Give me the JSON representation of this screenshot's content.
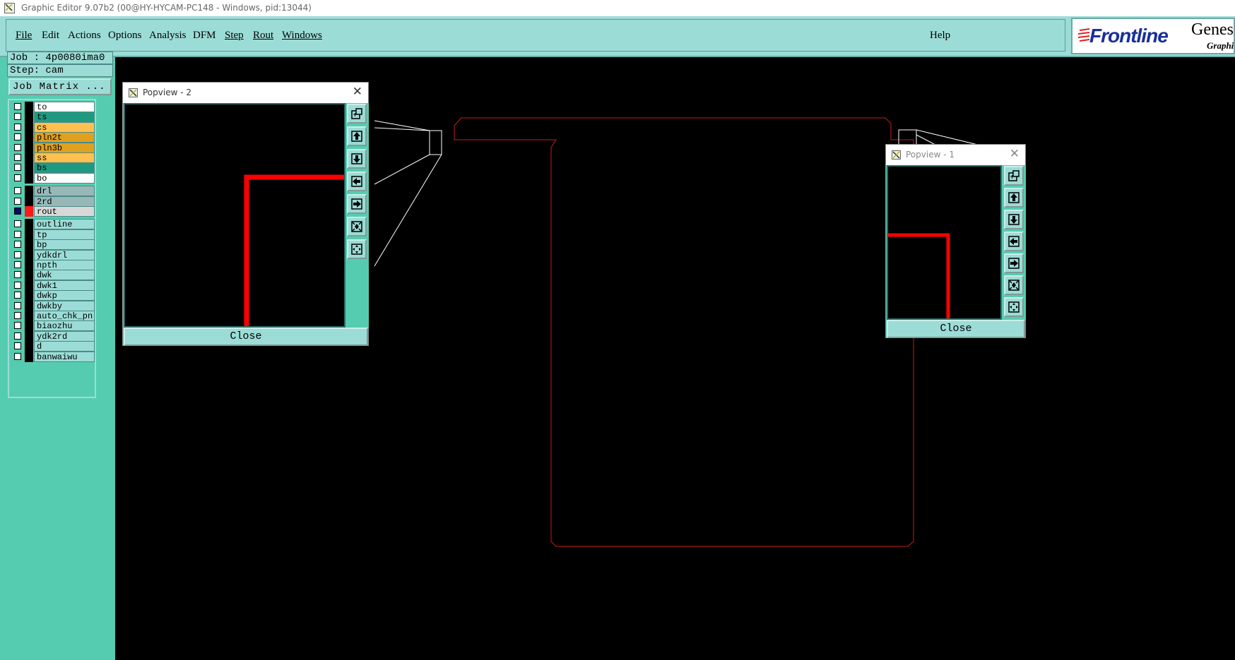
{
  "window": {
    "title": "Graphic Editor 9.07b2 (00@HY-HYCAM-PC148 - Windows, pid:13044)"
  },
  "menu": {
    "items": [
      "File",
      "Edit",
      "Actions",
      "Options",
      "Analysis",
      "DFM",
      "Step",
      "Rout",
      "Windows"
    ],
    "help": "Help"
  },
  "logo": {
    "brand": "Frontline",
    "product": "Genes",
    "subtitle": "Graphi"
  },
  "job": {
    "job_label": "Job : 4p0080ima0",
    "step_label": "Step: cam",
    "matrix_button": "Job Matrix ..."
  },
  "layers": [
    {
      "name": "to",
      "color": "#ffffff",
      "checked": false,
      "color_box": "#000000"
    },
    {
      "name": "ts",
      "color": "#1f9a80",
      "checked": false,
      "color_box": "#000000"
    },
    {
      "name": "cs",
      "color": "#ffc050",
      "checked": false,
      "color_box": "#000000"
    },
    {
      "name": "pln2t",
      "color": "#e0a020",
      "checked": false,
      "color_box": "#000000"
    },
    {
      "name": "pln3b",
      "color": "#e0a020",
      "checked": false,
      "color_box": "#000000"
    },
    {
      "name": "ss",
      "color": "#ffc050",
      "checked": false,
      "color_box": "#000000"
    },
    {
      "name": "bs",
      "color": "#1f9a80",
      "checked": false,
      "color_box": "#000000"
    },
    {
      "name": "bo",
      "color": "#ffffff",
      "checked": false,
      "color_box": "#000000"
    },
    {
      "name": "drl",
      "color": "#98b8b8",
      "checked": false,
      "color_box": "#000000"
    },
    {
      "name": "2rd",
      "color": "#98b8b8",
      "checked": false,
      "color_box": "#000000"
    },
    {
      "name": "rout",
      "color": "#d8d8d8",
      "checked": true,
      "color_box": "#ff1a1a"
    },
    {
      "name": "outline",
      "color": "#9cdcd6",
      "checked": false,
      "color_box": "#000000"
    },
    {
      "name": "tp",
      "color": "#9cdcd6",
      "checked": false,
      "color_box": "#000000"
    },
    {
      "name": "bp",
      "color": "#9cdcd6",
      "checked": false,
      "color_box": "#000000"
    },
    {
      "name": "ydkdrl",
      "color": "#9cdcd6",
      "checked": false,
      "color_box": "#000000"
    },
    {
      "name": "npth",
      "color": "#9cdcd6",
      "checked": false,
      "color_box": "#000000"
    },
    {
      "name": "dwk",
      "color": "#9cdcd6",
      "checked": false,
      "color_box": "#000000"
    },
    {
      "name": "dwk1",
      "color": "#9cdcd6",
      "checked": false,
      "color_box": "#000000"
    },
    {
      "name": "dwkp",
      "color": "#9cdcd6",
      "checked": false,
      "color_box": "#000000"
    },
    {
      "name": "dwkby",
      "color": "#9cdcd6",
      "checked": false,
      "color_box": "#000000"
    },
    {
      "name": "auto_chk_pn",
      "color": "#9cdcd6",
      "checked": false,
      "color_box": "#000000"
    },
    {
      "name": "biaozhu",
      "color": "#9cdcd6",
      "checked": false,
      "color_box": "#000000"
    },
    {
      "name": "ydk2rd",
      "color": "#9cdcd6",
      "checked": false,
      "color_box": "#000000"
    },
    {
      "name": "d",
      "color": "#9cdcd6",
      "checked": false,
      "color_box": "#000000"
    },
    {
      "name": "banwaiwu",
      "color": "#9cdcd6",
      "checked": false,
      "color_box": "#000000"
    }
  ],
  "popview2": {
    "title": "Popview - 2",
    "close": "Close"
  },
  "popview1": {
    "title": "Popview - 1",
    "close": "Close"
  },
  "colors": {
    "panel": "#55ccb0",
    "menubar": "#9cdcd6",
    "profile": "#cc1a1a",
    "rout": "#ff0000"
  }
}
